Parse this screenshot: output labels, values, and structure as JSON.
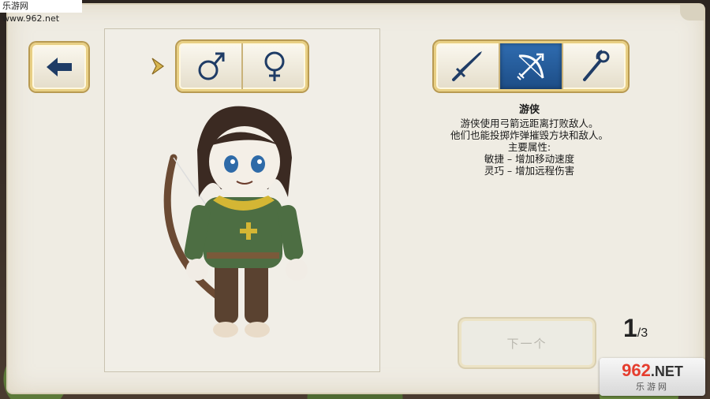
{
  "watermark_top": "乐游网 www.962.net",
  "gender": {
    "male_icon": "male-symbol-icon",
    "female_icon": "female-symbol-icon"
  },
  "classes": [
    {
      "name": "sword-icon",
      "active": false
    },
    {
      "name": "bow-icon",
      "active": true
    },
    {
      "name": "staff-icon",
      "active": false
    }
  ],
  "description": {
    "title": "游侠",
    "line1": "游侠使用弓箭远距离打败敌人。",
    "line2": "他们也能投掷炸弹摧毁方块和敌人。",
    "attr_header": "主要属性:",
    "attr1": "敏捷 – 增加移动速度",
    "attr2": "灵巧 – 增加远程伤害"
  },
  "next_label": "下一个",
  "page": {
    "current": "1",
    "total": "/3"
  },
  "watermark_bottom": {
    "num_red": "962",
    "num_dark": ".NET",
    "sub": "乐游网"
  },
  "colors": {
    "active_class_bg": "#2f6cb0",
    "frame_gold": "#e8cf84"
  }
}
